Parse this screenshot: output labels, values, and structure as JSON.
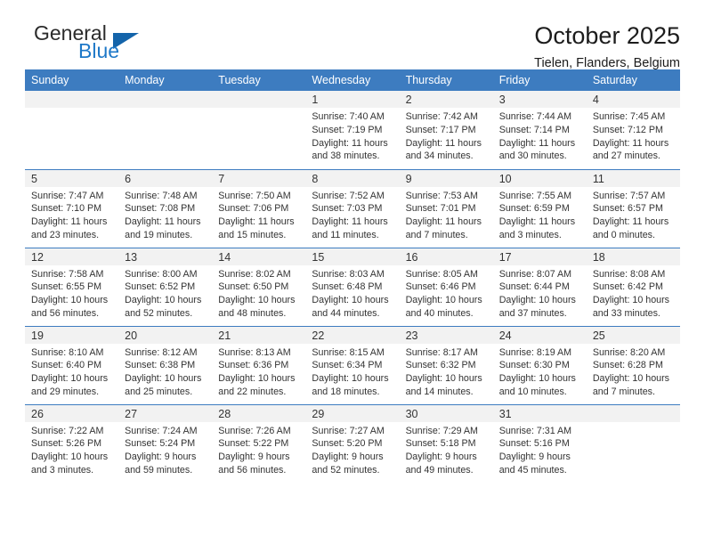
{
  "logo": {
    "word1": "General",
    "word2": "Blue",
    "triangle_color": "#1464aa",
    "blue_color": "#1e78c8"
  },
  "header": {
    "title": "October 2025",
    "subtitle": "Tielen, Flanders, Belgium"
  },
  "theme": {
    "header_blue": "#3d7cc0",
    "daynum_gray": "#f2f2f2",
    "text": "#333333"
  },
  "weekday_headers": [
    "Sunday",
    "Monday",
    "Tuesday",
    "Wednesday",
    "Thursday",
    "Friday",
    "Saturday"
  ],
  "labels": {
    "sunrise": "Sunrise:",
    "sunset": "Sunset:",
    "daylight": "Daylight:"
  },
  "weeks": [
    [
      {
        "day": "",
        "empty": true
      },
      {
        "day": "",
        "empty": true
      },
      {
        "day": "",
        "empty": true
      },
      {
        "day": "1",
        "sunrise": "Sunrise: 7:40 AM",
        "sunset": "Sunset: 7:19 PM",
        "daylight": "Daylight: 11 hours and 38 minutes."
      },
      {
        "day": "2",
        "sunrise": "Sunrise: 7:42 AM",
        "sunset": "Sunset: 7:17 PM",
        "daylight": "Daylight: 11 hours and 34 minutes."
      },
      {
        "day": "3",
        "sunrise": "Sunrise: 7:44 AM",
        "sunset": "Sunset: 7:14 PM",
        "daylight": "Daylight: 11 hours and 30 minutes."
      },
      {
        "day": "4",
        "sunrise": "Sunrise: 7:45 AM",
        "sunset": "Sunset: 7:12 PM",
        "daylight": "Daylight: 11 hours and 27 minutes."
      }
    ],
    [
      {
        "day": "5",
        "sunrise": "Sunrise: 7:47 AM",
        "sunset": "Sunset: 7:10 PM",
        "daylight": "Daylight: 11 hours and 23 minutes."
      },
      {
        "day": "6",
        "sunrise": "Sunrise: 7:48 AM",
        "sunset": "Sunset: 7:08 PM",
        "daylight": "Daylight: 11 hours and 19 minutes."
      },
      {
        "day": "7",
        "sunrise": "Sunrise: 7:50 AM",
        "sunset": "Sunset: 7:06 PM",
        "daylight": "Daylight: 11 hours and 15 minutes."
      },
      {
        "day": "8",
        "sunrise": "Sunrise: 7:52 AM",
        "sunset": "Sunset: 7:03 PM",
        "daylight": "Daylight: 11 hours and 11 minutes."
      },
      {
        "day": "9",
        "sunrise": "Sunrise: 7:53 AM",
        "sunset": "Sunset: 7:01 PM",
        "daylight": "Daylight: 11 hours and 7 minutes."
      },
      {
        "day": "10",
        "sunrise": "Sunrise: 7:55 AM",
        "sunset": "Sunset: 6:59 PM",
        "daylight": "Daylight: 11 hours and 3 minutes."
      },
      {
        "day": "11",
        "sunrise": "Sunrise: 7:57 AM",
        "sunset": "Sunset: 6:57 PM",
        "daylight": "Daylight: 11 hours and 0 minutes."
      }
    ],
    [
      {
        "day": "12",
        "sunrise": "Sunrise: 7:58 AM",
        "sunset": "Sunset: 6:55 PM",
        "daylight": "Daylight: 10 hours and 56 minutes."
      },
      {
        "day": "13",
        "sunrise": "Sunrise: 8:00 AM",
        "sunset": "Sunset: 6:52 PM",
        "daylight": "Daylight: 10 hours and 52 minutes."
      },
      {
        "day": "14",
        "sunrise": "Sunrise: 8:02 AM",
        "sunset": "Sunset: 6:50 PM",
        "daylight": "Daylight: 10 hours and 48 minutes."
      },
      {
        "day": "15",
        "sunrise": "Sunrise: 8:03 AM",
        "sunset": "Sunset: 6:48 PM",
        "daylight": "Daylight: 10 hours and 44 minutes."
      },
      {
        "day": "16",
        "sunrise": "Sunrise: 8:05 AM",
        "sunset": "Sunset: 6:46 PM",
        "daylight": "Daylight: 10 hours and 40 minutes."
      },
      {
        "day": "17",
        "sunrise": "Sunrise: 8:07 AM",
        "sunset": "Sunset: 6:44 PM",
        "daylight": "Daylight: 10 hours and 37 minutes."
      },
      {
        "day": "18",
        "sunrise": "Sunrise: 8:08 AM",
        "sunset": "Sunset: 6:42 PM",
        "daylight": "Daylight: 10 hours and 33 minutes."
      }
    ],
    [
      {
        "day": "19",
        "sunrise": "Sunrise: 8:10 AM",
        "sunset": "Sunset: 6:40 PM",
        "daylight": "Daylight: 10 hours and 29 minutes."
      },
      {
        "day": "20",
        "sunrise": "Sunrise: 8:12 AM",
        "sunset": "Sunset: 6:38 PM",
        "daylight": "Daylight: 10 hours and 25 minutes."
      },
      {
        "day": "21",
        "sunrise": "Sunrise: 8:13 AM",
        "sunset": "Sunset: 6:36 PM",
        "daylight": "Daylight: 10 hours and 22 minutes."
      },
      {
        "day": "22",
        "sunrise": "Sunrise: 8:15 AM",
        "sunset": "Sunset: 6:34 PM",
        "daylight": "Daylight: 10 hours and 18 minutes."
      },
      {
        "day": "23",
        "sunrise": "Sunrise: 8:17 AM",
        "sunset": "Sunset: 6:32 PM",
        "daylight": "Daylight: 10 hours and 14 minutes."
      },
      {
        "day": "24",
        "sunrise": "Sunrise: 8:19 AM",
        "sunset": "Sunset: 6:30 PM",
        "daylight": "Daylight: 10 hours and 10 minutes."
      },
      {
        "day": "25",
        "sunrise": "Sunrise: 8:20 AM",
        "sunset": "Sunset: 6:28 PM",
        "daylight": "Daylight: 10 hours and 7 minutes."
      }
    ],
    [
      {
        "day": "26",
        "sunrise": "Sunrise: 7:22 AM",
        "sunset": "Sunset: 5:26 PM",
        "daylight": "Daylight: 10 hours and 3 minutes."
      },
      {
        "day": "27",
        "sunrise": "Sunrise: 7:24 AM",
        "sunset": "Sunset: 5:24 PM",
        "daylight": "Daylight: 9 hours and 59 minutes."
      },
      {
        "day": "28",
        "sunrise": "Sunrise: 7:26 AM",
        "sunset": "Sunset: 5:22 PM",
        "daylight": "Daylight: 9 hours and 56 minutes."
      },
      {
        "day": "29",
        "sunrise": "Sunrise: 7:27 AM",
        "sunset": "Sunset: 5:20 PM",
        "daylight": "Daylight: 9 hours and 52 minutes."
      },
      {
        "day": "30",
        "sunrise": "Sunrise: 7:29 AM",
        "sunset": "Sunset: 5:18 PM",
        "daylight": "Daylight: 9 hours and 49 minutes."
      },
      {
        "day": "31",
        "sunrise": "Sunrise: 7:31 AM",
        "sunset": "Sunset: 5:16 PM",
        "daylight": "Daylight: 9 hours and 45 minutes."
      },
      {
        "day": "",
        "empty": true
      }
    ]
  ]
}
